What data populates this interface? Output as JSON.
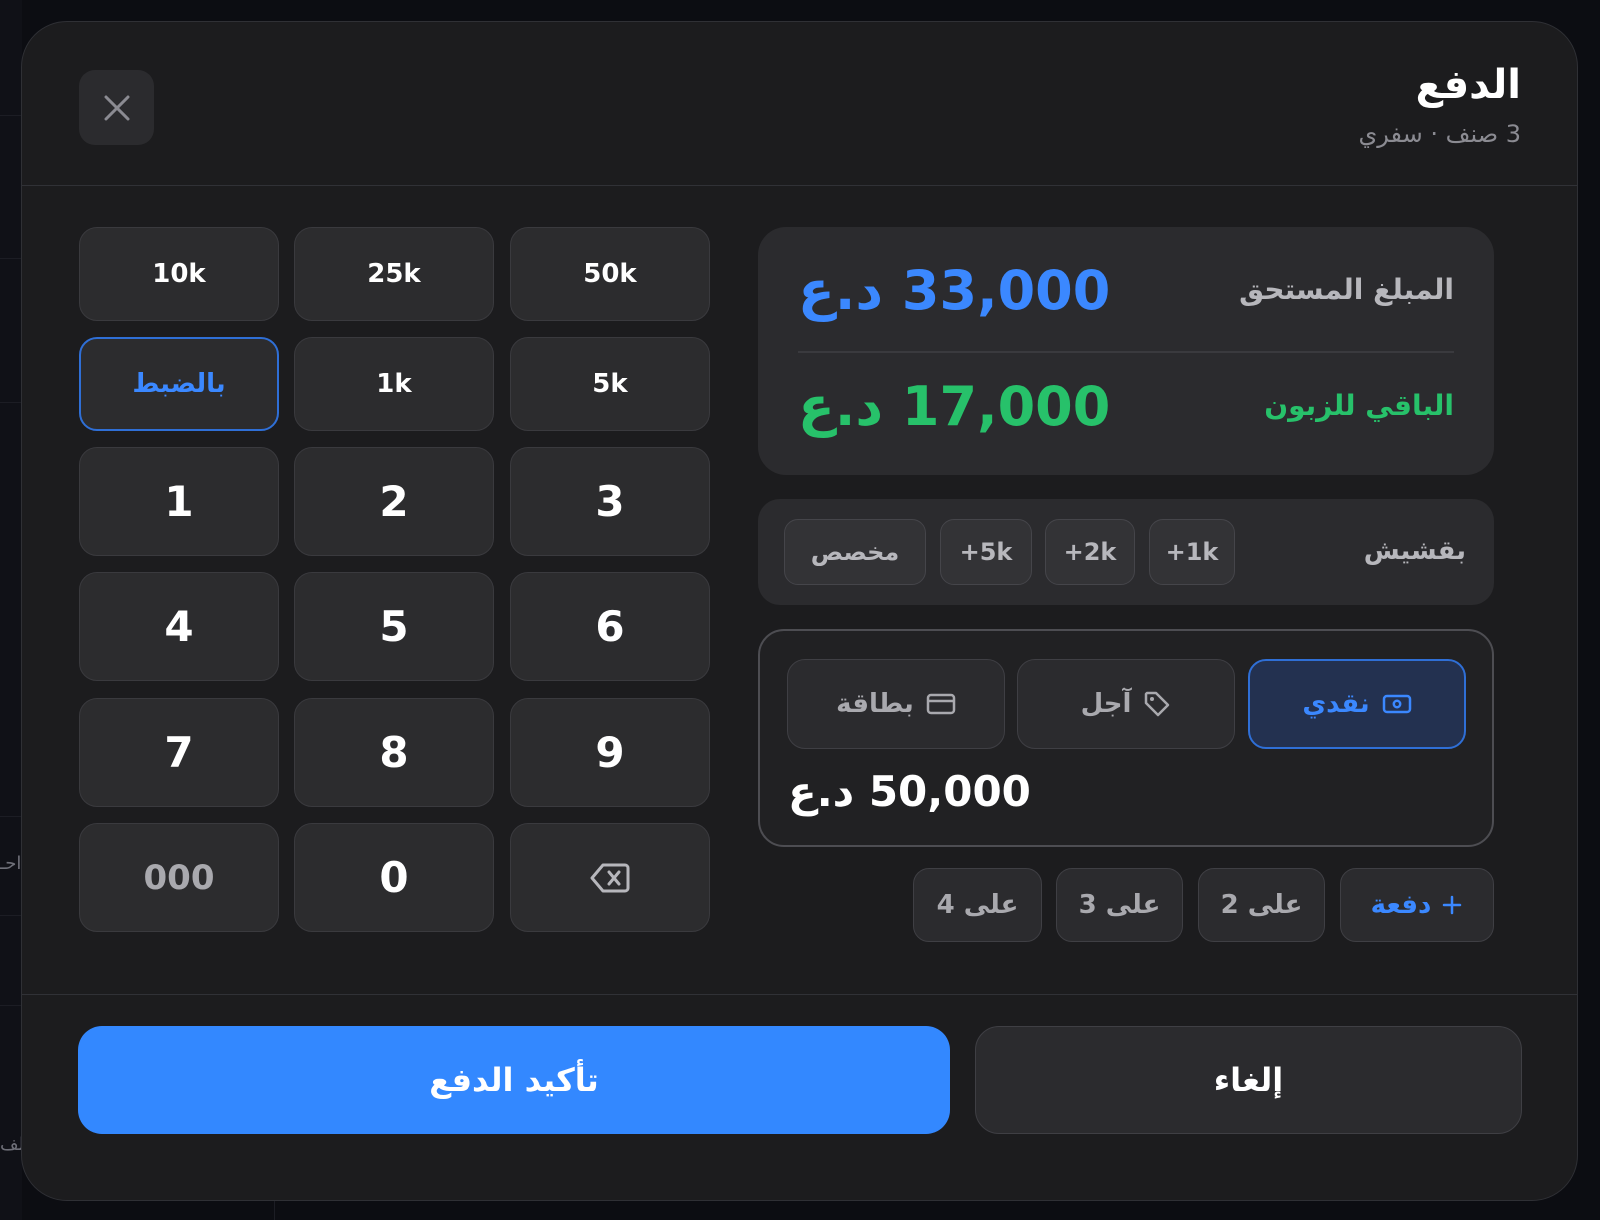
{
  "background": {
    "partial_text_1": "احـ",
    "partial_text_2": "الف"
  },
  "header": {
    "title": "الدفع",
    "subtitle": "3 صنف · سفري",
    "close_icon": "close-icon"
  },
  "keypad": {
    "quick_amounts": [
      "10k",
      "25k",
      "50k"
    ],
    "quick_amounts_row2": [
      "بالضبط",
      "1k",
      "5k"
    ],
    "digits": [
      "1",
      "2",
      "3",
      "4",
      "5",
      "6",
      "7",
      "8",
      "9"
    ],
    "triple_zero": "000",
    "zero": "0",
    "backspace_icon": "backspace-icon"
  },
  "summary": {
    "due_label": "المبلغ المستحق",
    "due_value": "33,000 د.ع",
    "change_label": "الباقي للزبون",
    "change_value": "17,000 د.ع",
    "due_color": "#3b88ff",
    "change_color": "#27c16a"
  },
  "tip": {
    "label": "بقشيش",
    "options": [
      "1k+",
      "2k+",
      "5k+",
      "مخصص"
    ]
  },
  "payment_method": {
    "methods": [
      {
        "label": "نقدي",
        "icon": "cash-icon",
        "active": true
      },
      {
        "label": "آجل",
        "icon": "tag-icon",
        "active": false
      },
      {
        "label": "بطاقة",
        "icon": "card-icon",
        "active": false
      }
    ],
    "paid_value": "50,000 د.ع"
  },
  "split": {
    "add_label": "دفعة",
    "options": [
      "على 2",
      "على 3",
      "على 4"
    ]
  },
  "footer": {
    "confirm_label": "تأكيد الدفع",
    "cancel_label": "إلغاء",
    "accent_color": "#3388ff"
  }
}
